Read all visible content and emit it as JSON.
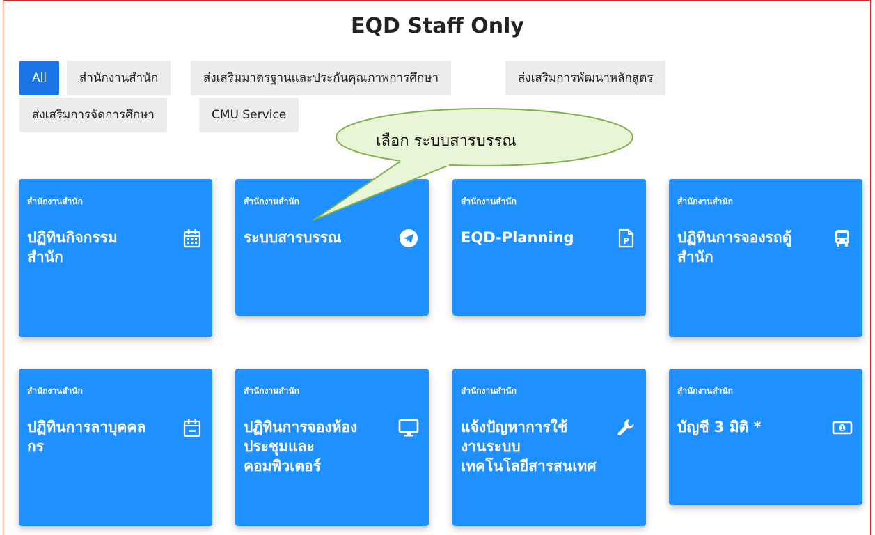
{
  "page": {
    "title": "EQD Staff Only"
  },
  "filters": [
    {
      "label": "All"
    },
    {
      "label": "สำนักงานสำนัก"
    },
    {
      "label": "ส่งเสริมมาตรฐานและประกันคุณภาพการศึกษา"
    },
    {
      "label": "ส่งเสริมการพัฒนาหลักสูตร"
    },
    {
      "label": "ส่งเสริมการจัดการศึกษา"
    },
    {
      "label": "CMU Service"
    }
  ],
  "callout": {
    "text": "เลือก ระบบสารบรรณ"
  },
  "cards": [
    {
      "category": "สำนักงานสำนัก",
      "title": "ปฏิทินกิจกรรม\nสำนัก",
      "icon": "calendar-icon"
    },
    {
      "category": "สำนักงานสำนัก",
      "title": "ระบบสารบรรณ",
      "icon": "telegram-icon"
    },
    {
      "category": "สำนักงานสำนัก",
      "title": "EQD-Planning",
      "icon": "file-p-icon"
    },
    {
      "category": "สำนักงานสำนัก",
      "title": "ปฏิทินการจองรถตู้\nสำนัก",
      "icon": "bus-icon"
    },
    {
      "category": "สำนักงานสำนัก",
      "title": "ปฏิทินการลาบุคคล\nกร",
      "icon": "calendar-minus-icon"
    },
    {
      "category": "สำนักงานสำนัก",
      "title": "ปฏิทินการจองห้อง\nประชุมและ\nคอมพิวเตอร์",
      "icon": "desktop-icon"
    },
    {
      "category": "สำนักงานสำนัก",
      "title": "แจ้งปัญหาการใช้\nงานระบบ\nเทคโนโลยีสารสนเทศ",
      "icon": "wrench-icon"
    },
    {
      "category": "สำนักงานสำนัก",
      "title": "บัญชี 3 มิติ *",
      "icon": "money-icon"
    }
  ],
  "colors": {
    "accent": "#1e90ff",
    "active_filter": "#1b74e4",
    "frame": "#c9322d",
    "callout_fill": "#e8f5d6",
    "callout_stroke": "#7fb24b"
  }
}
